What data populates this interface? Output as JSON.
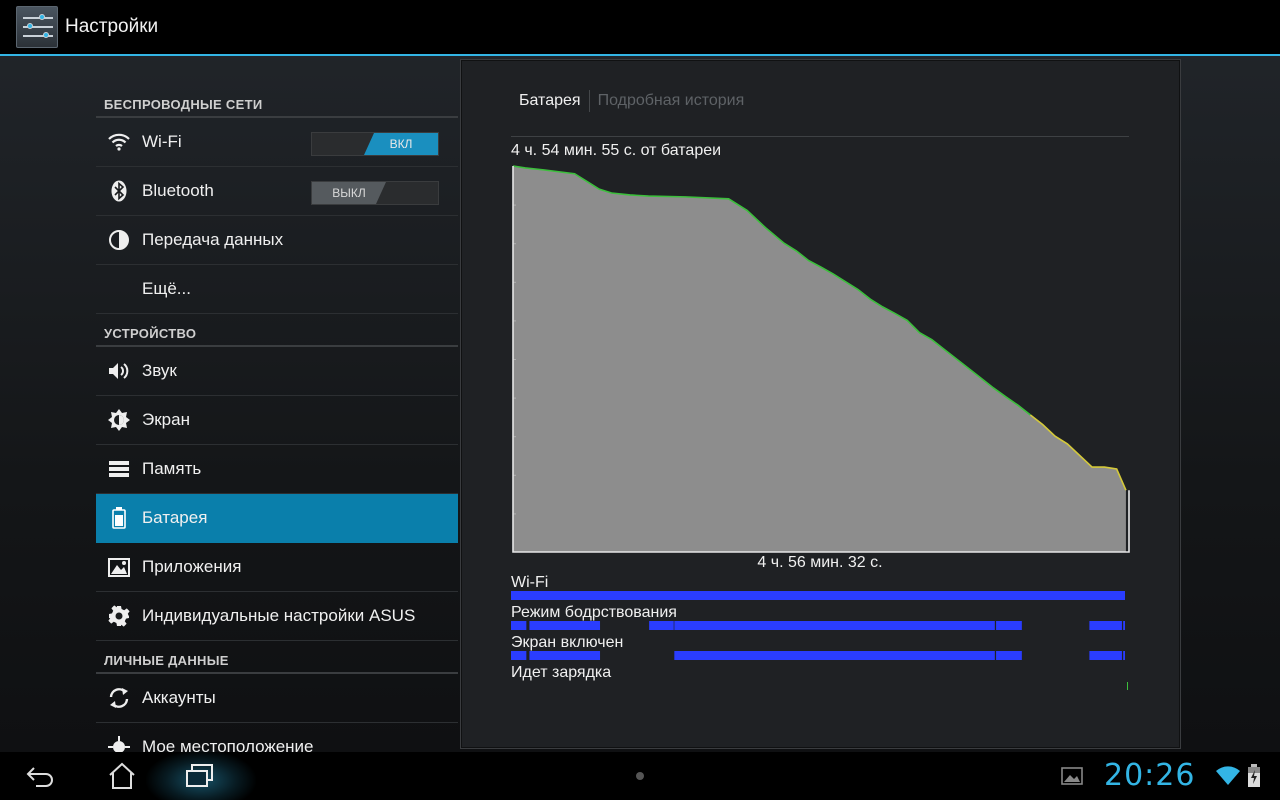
{
  "action_bar": {
    "title": "Настройки"
  },
  "sections": {
    "wireless": "БЕСПРОВОДНЫЕ СЕТИ",
    "device": "УСТРОЙСТВО",
    "personal": "ЛИЧНЫЕ ДАННЫЕ"
  },
  "items": {
    "wifi": {
      "label": "Wi-Fi",
      "switch": "ВКЛ"
    },
    "bluetooth": {
      "label": "Bluetooth",
      "switch": "ВЫКЛ"
    },
    "data": "Передача данных",
    "more": "Ещё...",
    "sound": "Звук",
    "display": "Экран",
    "storage": "Память",
    "battery": "Батарея",
    "apps": "Приложения",
    "asus": "Индивидуальные настройки ASUS",
    "accounts": "Аккаунты",
    "location": "Мое местоположение"
  },
  "detail": {
    "tabs": [
      "Батарея",
      "Подробная история"
    ],
    "top_label": "4 ч. 54 мин. 55 с. от батареи",
    "bottom_label": "4 ч. 56 мин. 32 с."
  },
  "chart_data": {
    "type": "area",
    "ylim": [
      0,
      100
    ],
    "xlim": [
      0,
      100
    ],
    "x": [
      0,
      2,
      5,
      10,
      12,
      14,
      16,
      19,
      22,
      28,
      35,
      38,
      41,
      44,
      46,
      48,
      50,
      52,
      54,
      56,
      58,
      60,
      62,
      64,
      66,
      68,
      70,
      72,
      74,
      76,
      78,
      80,
      82,
      84,
      86,
      88,
      90,
      94,
      96,
      98,
      99.5
    ],
    "values": [
      100,
      99.5,
      99,
      98,
      96,
      94,
      93,
      92.5,
      92.2,
      92,
      91.5,
      88.5,
      84,
      80,
      78,
      75.5,
      73.8,
      72,
      70,
      68,
      65.5,
      63.5,
      61.8,
      60,
      56.8,
      55,
      52.5,
      50,
      47.5,
      45,
      42.5,
      40.2,
      38,
      35.5,
      33,
      30,
      28,
      22,
      22,
      21.5,
      16
    ],
    "colors": {
      "line_discharge": "#3cbf3c",
      "line_recent": "#d4c93a",
      "fill": "#8d8d8d"
    }
  },
  "tracks": [
    {
      "label": "Wi-Fi",
      "segments": [
        [
          0,
          100
        ]
      ]
    },
    {
      "label": "Режим бодрствования",
      "segments": [
        [
          0,
          2.5
        ],
        [
          3,
          14.5
        ],
        [
          22.5,
          26.5
        ],
        [
          26.6,
          78.8
        ],
        [
          79,
          83.2
        ],
        [
          94.2,
          99.5
        ],
        [
          99.7,
          100
        ]
      ]
    },
    {
      "label": "Экран включен",
      "segments": [
        [
          0,
          2.5
        ],
        [
          3,
          14.5
        ],
        [
          26.6,
          78.8
        ],
        [
          79,
          83.2
        ],
        [
          94.2,
          99.5
        ],
        [
          99.7,
          100
        ]
      ]
    },
    {
      "label": "Идет зарядка",
      "segments": []
    }
  ],
  "track_color": "#2a3dff",
  "status": {
    "clock": "20:26"
  }
}
